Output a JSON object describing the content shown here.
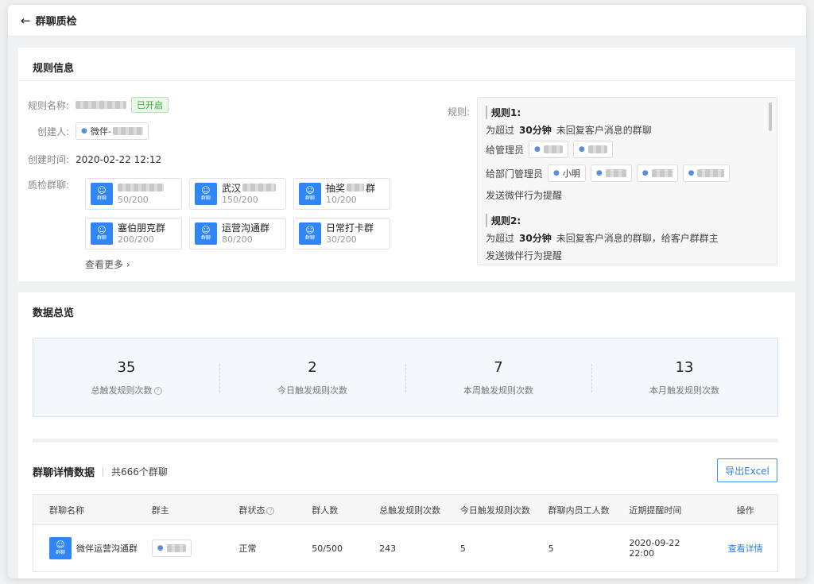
{
  "header": {
    "back_icon": "arrow-left-icon",
    "title": "群聊质检"
  },
  "rule_info": {
    "title": "规则信息",
    "name_label": "规则名称:",
    "status_badge": "已开启",
    "creator_label": "创建人:",
    "creator_prefix": "微伴-",
    "created_label": "创建时间:",
    "created_value": "2020-02-22 12:12",
    "groups_label": "质检群聊:",
    "group_avatar_label": "群聊",
    "groups": [
      {
        "name": "",
        "count": "50/200"
      },
      {
        "name": "武汉",
        "count": "150/200"
      },
      {
        "name": "抽奖",
        "name_suffix": "群",
        "count": "10/200"
      },
      {
        "name": "塞伯朋克群",
        "count": "200/200"
      },
      {
        "name": "运营沟通群",
        "count": "80/200"
      },
      {
        "name": "日常打卡群",
        "count": "30/200"
      }
    ],
    "see_more": "查看更多",
    "rules_label": "规则:",
    "rule1": {
      "title": "规则1:",
      "line1_prefix": "为超过",
      "line1_time": "30分钟",
      "line1_suffix": "未回复客户消息的群聊",
      "admin_label": "给管理员",
      "dept_label": "给部门管理员",
      "dept_user": "小明",
      "action": "发送微伴行为提醒"
    },
    "rule2": {
      "title": "规则2:",
      "line1_prefix": "为超过",
      "line1_time": "30分钟",
      "line1_suffix": "未回复客户消息的群聊，给客户群群主",
      "action": "发送微伴行为提醒"
    }
  },
  "overview": {
    "title": "数据总览",
    "stats": [
      {
        "value": "35",
        "label": "总触发规则次数",
        "help": true
      },
      {
        "value": "2",
        "label": "今日触发规则次数"
      },
      {
        "value": "7",
        "label": "本周触发规则次数"
      },
      {
        "value": "13",
        "label": "本月触发规则次数"
      }
    ]
  },
  "details": {
    "title": "群聊详情数据",
    "count": "共666个群聊",
    "export": "导出Excel",
    "columns": [
      "群聊名称",
      "群主",
      "群状态",
      "群人数",
      "总触发规则次数",
      "今日触发规则次数",
      "群聊内员工人数",
      "近期提醒时间",
      "操作"
    ],
    "rows": [
      {
        "name": "微伴运营沟通群",
        "status": "正常",
        "members": "50/500",
        "total": "243",
        "today": "5",
        "staff": "5",
        "time_line1": "2020-09-22",
        "time_line2": "22:00",
        "action": "查看详情"
      }
    ]
  },
  "colors": {
    "accent": "#2f86f6",
    "link": "#2f7fe6",
    "badge_green": "#3aa63a"
  }
}
